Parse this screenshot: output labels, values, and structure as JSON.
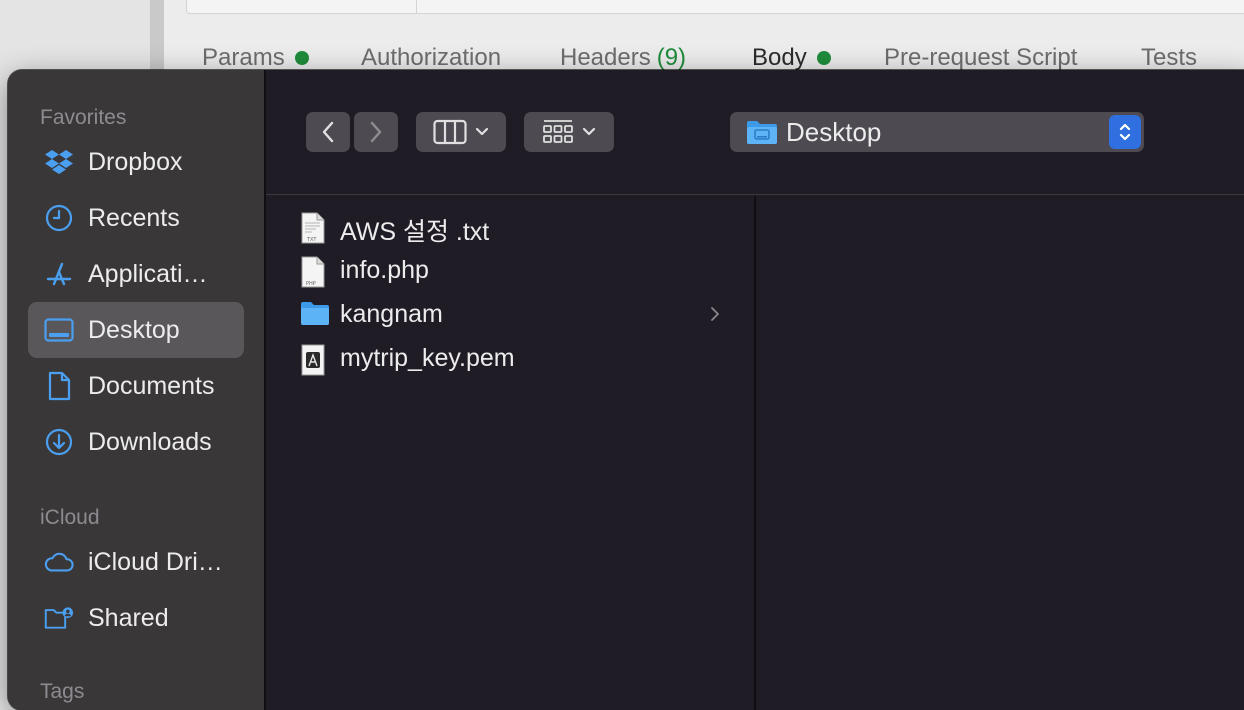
{
  "background_app": {
    "tabs": [
      {
        "label": "Params",
        "dot": true
      },
      {
        "label": "Authorization"
      },
      {
        "label": "Headers",
        "count": "(9)"
      },
      {
        "label": "Body",
        "dot": true
      },
      {
        "label": "Pre-request Script"
      },
      {
        "label": "Tests"
      }
    ]
  },
  "sidebar": {
    "favorites_header": "Favorites",
    "favorites": [
      {
        "label": "Dropbox",
        "icon": "dropbox-icon"
      },
      {
        "label": "Recents",
        "icon": "clock-icon"
      },
      {
        "label": "Applicati…",
        "icon": "applications-icon"
      },
      {
        "label": "Desktop",
        "icon": "desktop-icon",
        "selected": true
      },
      {
        "label": "Documents",
        "icon": "document-icon"
      },
      {
        "label": "Downloads",
        "icon": "download-icon"
      }
    ],
    "icloud_header": "iCloud",
    "icloud": [
      {
        "label": "iCloud Dri…",
        "icon": "cloud-icon"
      },
      {
        "label": "Shared",
        "icon": "shared-folder-icon"
      }
    ],
    "tags_header": "Tags"
  },
  "toolbar": {
    "location": "Desktop"
  },
  "files": [
    {
      "name": "AWS 설정 .txt",
      "icon": "txt-file-icon"
    },
    {
      "name": "info.php",
      "icon": "php-file-icon"
    },
    {
      "name": "kangnam",
      "icon": "folder-icon",
      "has_children": true
    },
    {
      "name": "mytrip_key.pem",
      "icon": "pem-file-icon"
    }
  ],
  "colors": {
    "accent": "#2f6fe0",
    "sidebar_icon": "#4a9ff0",
    "status_green": "#1f8c3b"
  }
}
